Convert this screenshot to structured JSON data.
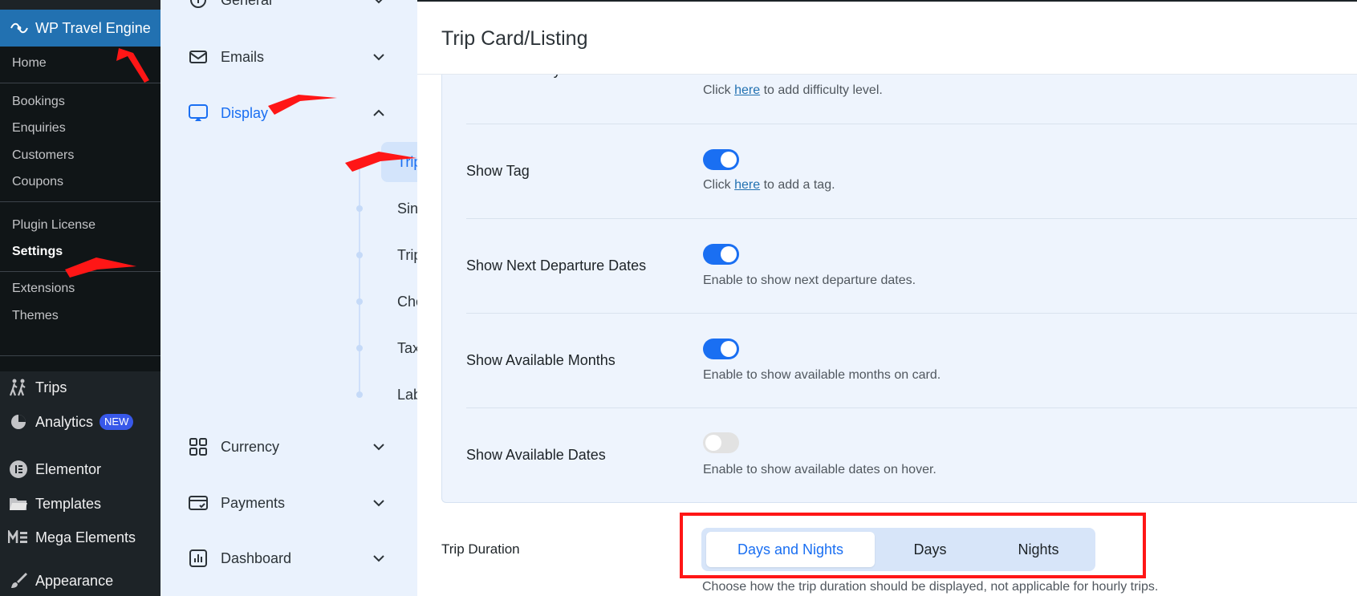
{
  "wp_sidebar": {
    "brand": "WP Travel Engine",
    "submenu": [
      {
        "label": "Home"
      },
      {
        "label": "Bookings"
      },
      {
        "label": "Enquiries"
      },
      {
        "label": "Customers"
      },
      {
        "label": "Coupons"
      },
      {
        "label": "Plugin License"
      },
      {
        "label": "Settings",
        "current": true
      },
      {
        "label": "Extensions"
      },
      {
        "label": "Themes"
      }
    ],
    "menu": [
      {
        "label": "Trips",
        "icon": "hikers-icon"
      },
      {
        "label": "Analytics",
        "icon": "pie-chart-icon",
        "badge": "NEW"
      },
      {
        "label": "Elementor",
        "icon": "elementor-icon"
      },
      {
        "label": "Templates",
        "icon": "folder-icon"
      },
      {
        "label": "Mega Elements",
        "icon": "mega-elements-icon"
      },
      {
        "label": "Appearance",
        "icon": "paintbrush-icon"
      }
    ]
  },
  "settings_nav": {
    "groups": [
      {
        "label": "General",
        "icon": "info-circle-icon"
      },
      {
        "label": "Emails",
        "icon": "envelope-icon"
      },
      {
        "label": "Display",
        "icon": "display-icon",
        "expanded": true
      },
      {
        "label": "Currency",
        "icon": "grid-icon"
      },
      {
        "label": "Payments",
        "icon": "card-icon"
      },
      {
        "label": "Dashboard",
        "icon": "bar-chart-icon"
      }
    ],
    "display_items": [
      {
        "label": "Trip Card/Listing",
        "active": true
      },
      {
        "label": "Single Trip"
      },
      {
        "label": "Trip Archive"
      },
      {
        "label": "Checkout"
      },
      {
        "label": "Taxonomy"
      },
      {
        "label": "Labels"
      }
    ]
  },
  "page": {
    "title": "Trip Card/Listing",
    "options": [
      {
        "label": "Show Difficulty",
        "desc_pre": "Click ",
        "link": "here",
        "desc_post": " to add difficulty level."
      },
      {
        "label": "Show Tag",
        "toggle": "on",
        "desc_pre": "Click ",
        "link": "here",
        "desc_post": " to add a tag."
      },
      {
        "label": "Show Next Departure Dates",
        "toggle": "on",
        "desc": "Enable to show next departure dates."
      },
      {
        "label": "Show Available Months",
        "toggle": "on",
        "desc": "Enable to show available months on card."
      },
      {
        "label": "Show Available Dates",
        "toggle": "off",
        "desc": "Enable to show available dates on hover."
      }
    ],
    "trip_duration": {
      "label": "Trip Duration",
      "options": [
        "Days and Nights",
        "Days",
        "Nights"
      ],
      "selected": "Days and Nights",
      "help": "Choose how the trip duration should be displayed, not applicable for hourly trips."
    }
  },
  "colors": {
    "accent": "#1a6ff2",
    "wp_admin_bg": "#1d2327",
    "annotation": "#ff1616"
  }
}
